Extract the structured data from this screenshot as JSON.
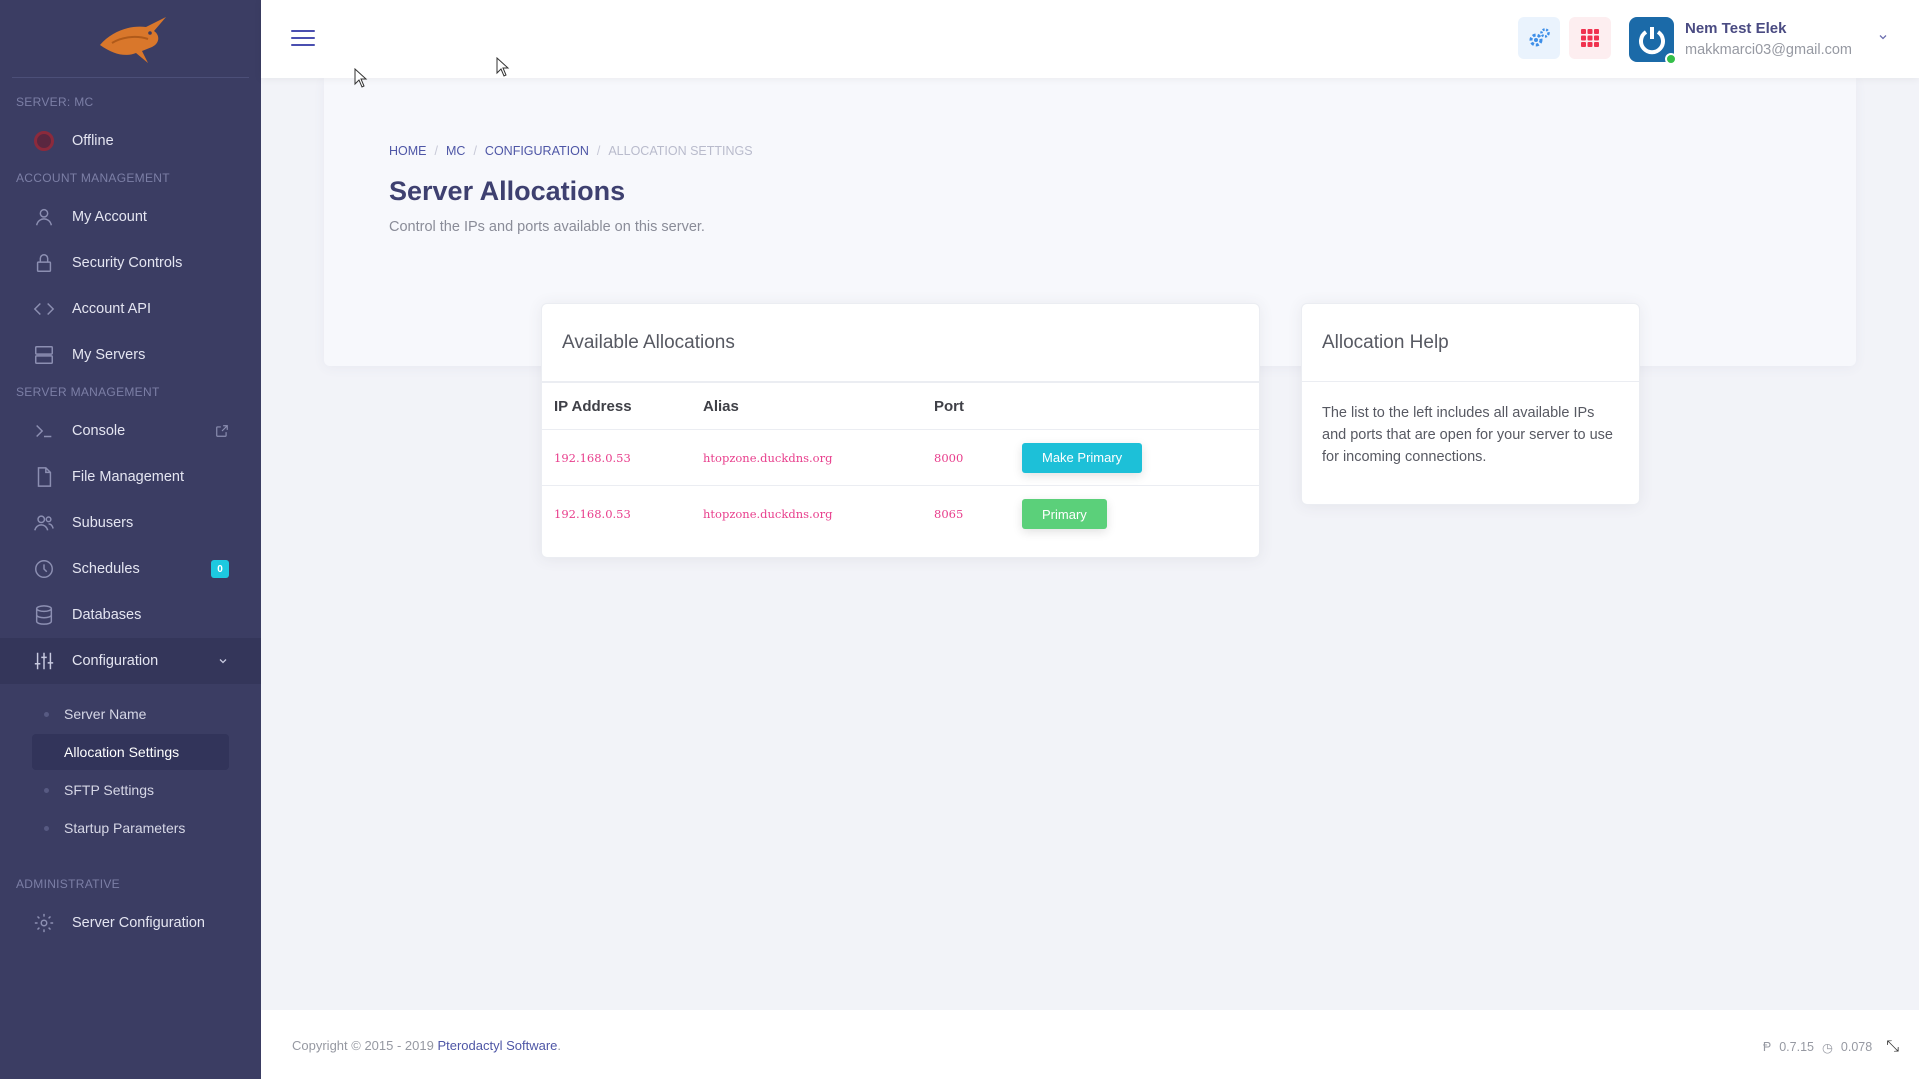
{
  "sidebar": {
    "server_section": "SERVER: MC",
    "status": "Offline",
    "account_section": "ACCOUNT MANAGEMENT",
    "account_items": [
      {
        "label": "My Account",
        "icon": "user-icon"
      },
      {
        "label": "Security Controls",
        "icon": "lock-icon"
      },
      {
        "label": "Account API",
        "icon": "code-icon"
      },
      {
        "label": "My Servers",
        "icon": "server-icon"
      }
    ],
    "server_mgmt_section": "SERVER MANAGEMENT",
    "server_items": [
      {
        "label": "Console",
        "icon": "terminal-icon"
      },
      {
        "label": "File Management",
        "icon": "file-icon"
      },
      {
        "label": "Subusers",
        "icon": "users-icon"
      },
      {
        "label": "Schedules",
        "icon": "clock-icon",
        "badge": "0"
      },
      {
        "label": "Databases",
        "icon": "database-icon"
      },
      {
        "label": "Configuration",
        "icon": "sliders-icon"
      }
    ],
    "config_sub": [
      "Server Name",
      "Allocation Settings",
      "SFTP Settings",
      "Startup Parameters"
    ],
    "admin_section": "ADMINISTRATIVE",
    "admin_item": "Server Configuration"
  },
  "topbar": {
    "user_name": "Nem Test Elek",
    "user_email": "makkmarci03@gmail.com"
  },
  "page": {
    "breadcrumb": [
      "HOME",
      "MC",
      "CONFIGURATION",
      "ALLOCATION SETTINGS"
    ],
    "title": "Server Allocations",
    "subtitle": "Control the IPs and ports available on this server."
  },
  "allocations": {
    "title": "Available Allocations",
    "headers": [
      "IP Address",
      "Alias",
      "Port"
    ],
    "rows": [
      {
        "ip": "192.168.0.53",
        "alias": "htopzone.duckdns.org",
        "port": "8000",
        "action": "Make Primary"
      },
      {
        "ip": "192.168.0.53",
        "alias": "htopzone.duckdns.org",
        "port": "8065",
        "action": "Primary"
      }
    ]
  },
  "help": {
    "title": "Allocation Help",
    "body": "The list to the left includes all available IPs and ports that are open for your server to use for incoming connections."
  },
  "footer": {
    "copyright_prefix": "Copyright © 2015 - 2019 ",
    "copyright_link": "Pterodactyl Software",
    "copyright_suffix": ".",
    "version": "0.7.15",
    "time": "0.078"
  },
  "colors": {
    "sidebar_bg": "#3b3d63",
    "accent": "#4e56a6",
    "make_primary_btn": "#1dc0d8",
    "primary_btn": "#5bd07a",
    "status_offline": "#c0283f"
  }
}
